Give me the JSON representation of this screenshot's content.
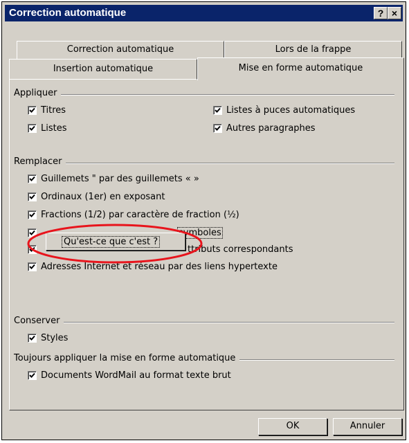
{
  "window": {
    "title": "Correction automatique",
    "help_btn": "?",
    "close_btn": "×"
  },
  "tabs": {
    "row1": [
      "Correction automatique",
      "Lors de la frappe"
    ],
    "row2": [
      "Insertion automatique",
      "Mise en forme automatique"
    ],
    "active": "Mise en forme automatique"
  },
  "sections": {
    "appliquer": {
      "title": "Appliquer",
      "titres": "Titres",
      "listes": "Listes",
      "puces": "Listes à puces automatiques",
      "autres": "Autres paragraphes"
    },
    "remplacer": {
      "title": "Remplacer",
      "guillemets": "Guillemets \" par des guillemets « »",
      "ordinaux": "Ordinaux (1er) en exposant",
      "fractions": "Fractions (1/2) par caractère de fraction (½)",
      "symboles_tail": "symboles",
      "attributs_tail": "ttributs correspondants",
      "adresses": "Adresses Internet et réseau par des liens hypertexte"
    },
    "conserver": {
      "title": "Conserver",
      "styles": "Styles"
    },
    "toujours": {
      "title": "Toujours appliquer la mise en forme automatique",
      "wordmail": "Documents WordMail au format texte brut"
    }
  },
  "popup": {
    "label": "Qu'est-ce que c'est ?"
  },
  "buttons": {
    "ok": "OK",
    "cancel": "Annuler"
  },
  "colors": {
    "title_bar": "#0a246a",
    "face": "#d4d0c8",
    "highlight_ellipse": "#e8141c"
  }
}
